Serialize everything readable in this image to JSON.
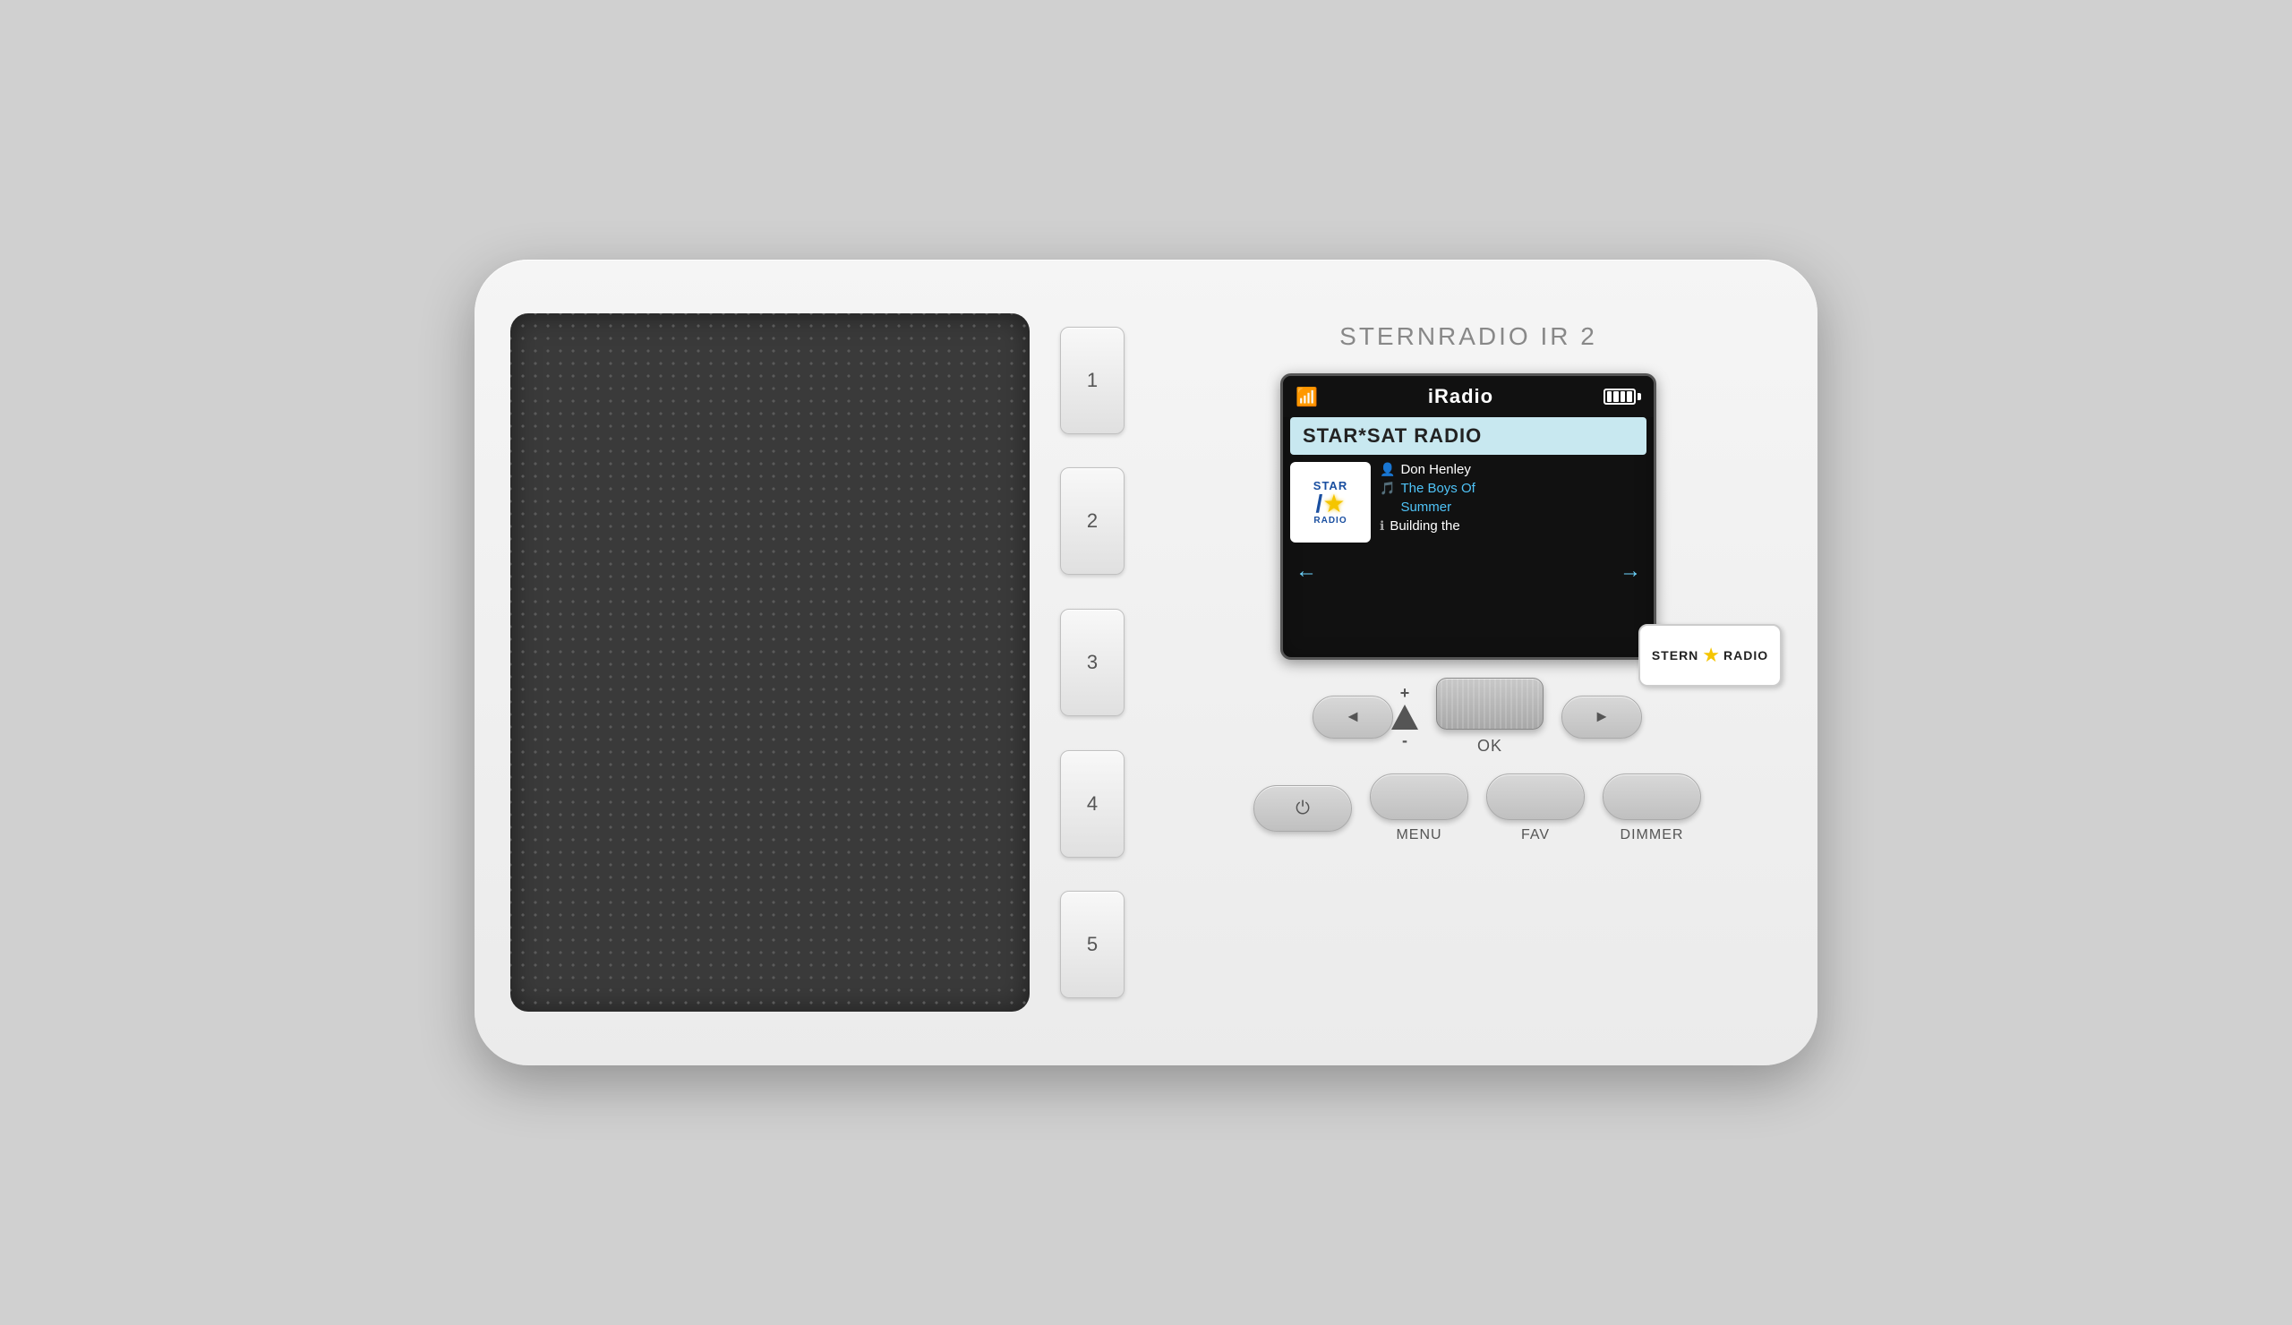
{
  "device": {
    "brand": "STERNRADIO IR 2",
    "screen": {
      "mode": "iRadio",
      "station": "STAR*SAT RADIO",
      "artist": "Don Henley",
      "song_line1": "The Boys Of",
      "song_line2": "Summer",
      "next_track": "Building the",
      "wifi_icon": "wifi",
      "battery_icon": "battery-full"
    },
    "presets": [
      "1",
      "2",
      "3",
      "4",
      "5"
    ],
    "controls": {
      "ok_label": "OK",
      "vol_plus": "+",
      "vol_minus": "-",
      "back_arrow": "◄",
      "forward_arrow": "►",
      "screen_left_arrow": "←",
      "screen_right_arrow": "→"
    },
    "buttons": {
      "power": "⏻",
      "menu": "MENU",
      "fav": "FAV",
      "dimmer": "DIMMER"
    },
    "logo": {
      "stern": "STERN",
      "radio": "RADIO"
    }
  }
}
